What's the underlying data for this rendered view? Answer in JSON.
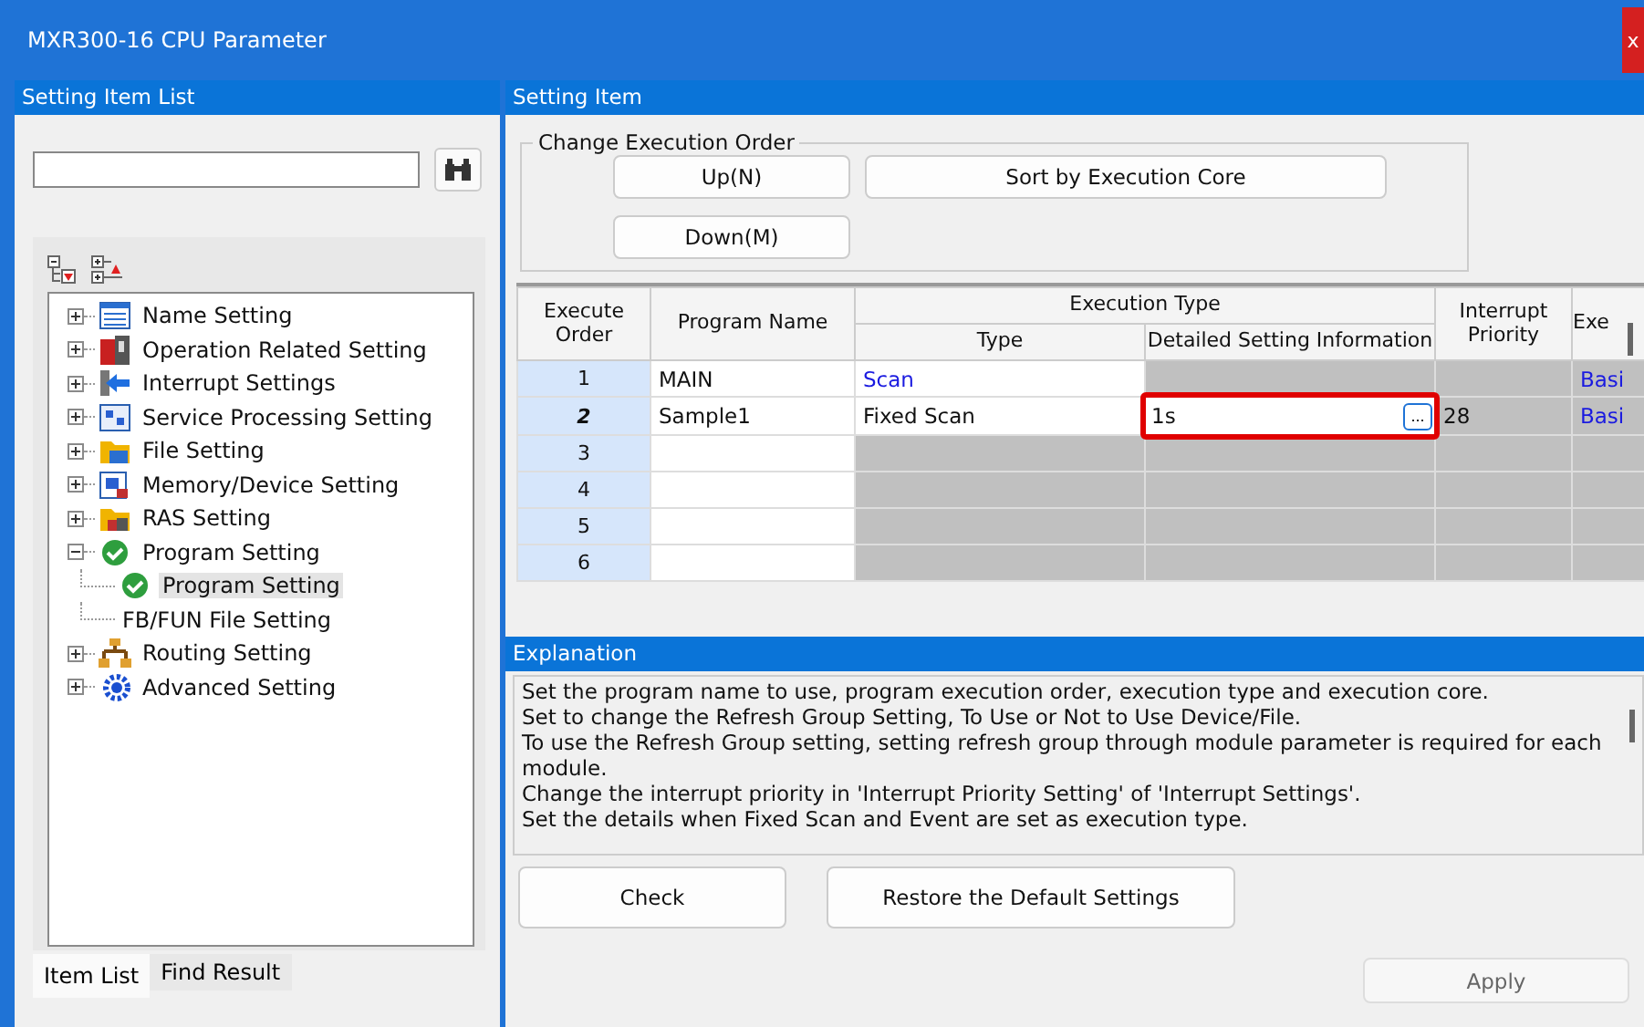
{
  "window": {
    "title": "MXR300-16 CPU Parameter",
    "close_label": "x"
  },
  "left_panel": {
    "title": "Setting Item List",
    "tree": [
      {
        "label": "Name Setting",
        "expanded": false,
        "selected": false
      },
      {
        "label": "Operation Related Setting",
        "expanded": false,
        "selected": false
      },
      {
        "label": "Interrupt Settings",
        "expanded": false,
        "selected": false
      },
      {
        "label": "Service Processing Setting",
        "expanded": false,
        "selected": false
      },
      {
        "label": "File Setting",
        "expanded": false,
        "selected": false
      },
      {
        "label": "Memory/Device Setting",
        "expanded": false,
        "selected": false
      },
      {
        "label": "RAS Setting",
        "expanded": false,
        "selected": false
      },
      {
        "label": "Program Setting",
        "expanded": true,
        "selected": false,
        "children": [
          {
            "label": "Program Setting",
            "selected": true
          },
          {
            "label": "FB/FUN File Setting",
            "selected": false
          }
        ]
      },
      {
        "label": "Routing Setting",
        "expanded": false,
        "selected": false
      },
      {
        "label": "Advanced Setting",
        "expanded": false,
        "selected": false
      }
    ],
    "tabs": [
      {
        "label": "Item List",
        "selected": true
      },
      {
        "label": "Find Result",
        "selected": false
      }
    ]
  },
  "right_panel": {
    "title": "Setting Item",
    "group": {
      "title": "Change Execution Order",
      "buttons": [
        "Up(N)",
        "Sort by Execution Core",
        "Down(M)"
      ]
    },
    "table": {
      "columns": {
        "order": "Execute Order",
        "name": "Program Name",
        "exec_type": "Execution Type",
        "type": "Type",
        "detail": "Detailed Setting Information",
        "priority": "Interrupt Priority",
        "column_6": "Exe"
      },
      "rows": [
        {
          "order": "1",
          "selected": false,
          "name": "MAIN",
          "type": {
            "text": "Scan",
            "kind": "link"
          },
          "detail": {
            "disabled": true,
            "editing": false
          },
          "priority": {
            "disabled": true
          },
          "core": {
            "text": "Basi",
            "disabled": true
          }
        },
        {
          "order": "2",
          "selected": true,
          "name": "Sample1",
          "type": {
            "text": "Fixed Scan",
            "kind": "plain"
          },
          "detail": {
            "text": "1s",
            "editing": true,
            "button": "..."
          },
          "priority": {
            "text": "28",
            "disabled": true
          },
          "core": {
            "text": "Basi",
            "disabled": true
          }
        },
        {
          "order": "3",
          "selected": false,
          "type": {
            "kind": "empty"
          },
          "detail": {
            "disabled": true,
            "editing": false
          },
          "priority": {
            "disabled": true
          },
          "core": {
            "disabled": true
          }
        },
        {
          "order": "4",
          "selected": false,
          "type": {
            "kind": "empty"
          },
          "detail": {
            "disabled": true,
            "editing": false
          },
          "priority": {
            "disabled": true
          },
          "core": {
            "disabled": true
          }
        },
        {
          "order": "5",
          "selected": false,
          "type": {
            "kind": "empty"
          },
          "detail": {
            "disabled": true,
            "editing": false
          },
          "priority": {
            "disabled": true
          },
          "core": {
            "disabled": true
          }
        },
        {
          "order": "6",
          "selected": false,
          "type": {
            "kind": "empty"
          },
          "detail": {
            "disabled": true,
            "editing": false
          },
          "priority": {
            "disabled": true
          },
          "core": {
            "disabled": true
          }
        }
      ]
    },
    "explanation": {
      "title": "Explanation",
      "lines": [
        "Set the program name to use, program execution order, execution type and execution core.",
        "Set to change the Refresh Group Setting, To Use or Not to Use Device/File.",
        "To use the Refresh Group setting, setting refresh group through module parameter is required for each module.",
        "Change the interrupt priority in 'Interrupt Priority Setting' of 'Interrupt Settings'.",
        "Set the details when Fixed Scan and Event are set as execution type."
      ]
    },
    "buttons": [
      "Check",
      "Restore the Default Settings"
    ],
    "apply": {
      "label": "Apply",
      "disabled": true
    }
  }
}
